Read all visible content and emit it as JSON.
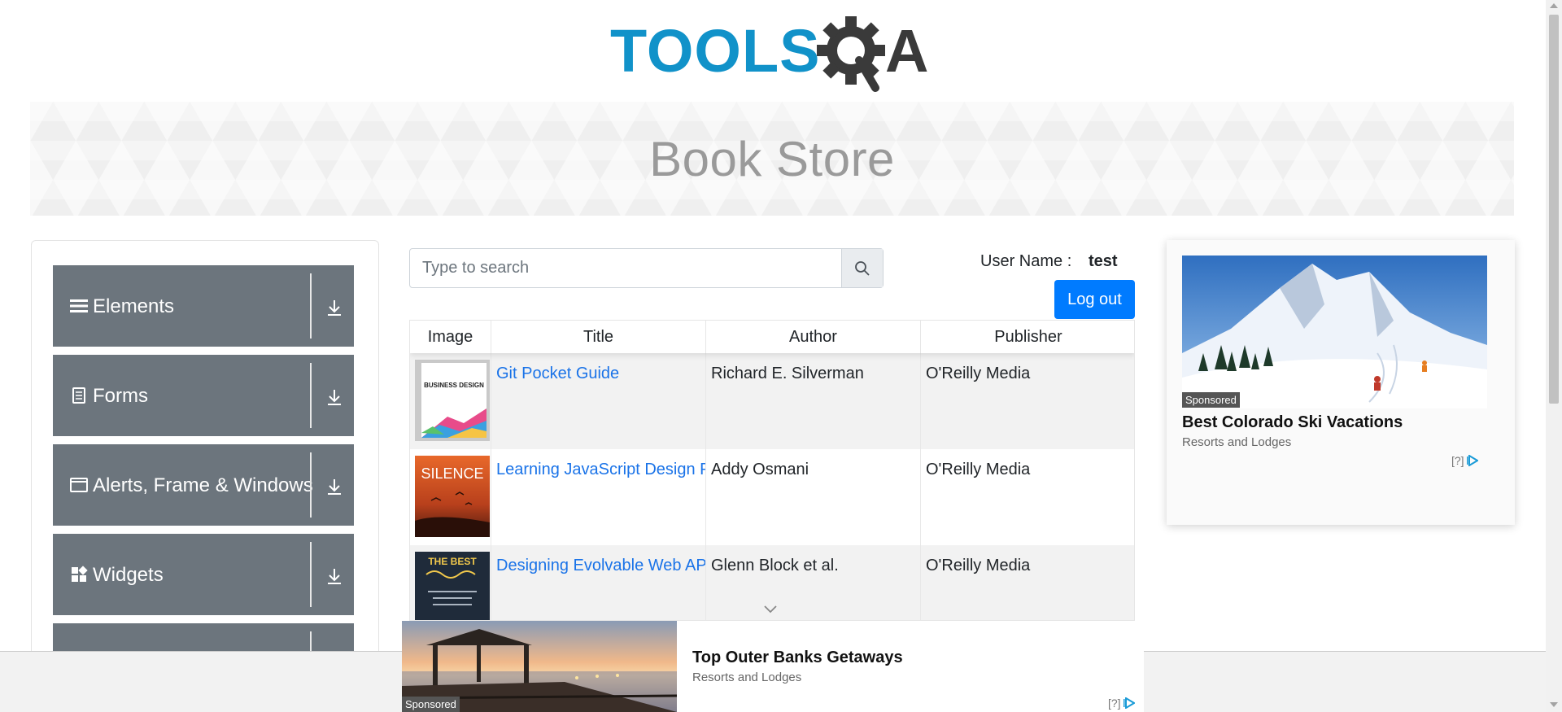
{
  "header": {
    "logo_text": "TOOLSQA"
  },
  "banner": {
    "title": "Book Store"
  },
  "sidebar": {
    "groups": [
      {
        "label": "Elements",
        "icon": "menu-lines-icon"
      },
      {
        "label": "Forms",
        "icon": "document-icon"
      },
      {
        "label": "Alerts, Frame & Windows",
        "icon": "window-icon"
      },
      {
        "label": "Widgets",
        "icon": "widgets-grid-icon"
      },
      {
        "label": "",
        "icon": ""
      }
    ]
  },
  "search": {
    "placeholder": "Type to search"
  },
  "user": {
    "label": "User Name :",
    "value": "test",
    "logout_label": "Log out"
  },
  "table": {
    "columns": [
      "Image",
      "Title",
      "Author",
      "Publisher"
    ],
    "rows": [
      {
        "title": "Git Pocket Guide",
        "author": "Richard E. Silverman",
        "publisher": "O'Reilly Media",
        "cover": "BUSINESS DESIGN"
      },
      {
        "title": "Learning JavaScript Design Patterns",
        "author": "Addy Osmani",
        "publisher": "O'Reilly Media",
        "cover": "SILENCE"
      },
      {
        "title": "Designing Evolvable Web APIs with ASP.NET",
        "author": "Glenn Block et al.",
        "publisher": "O'Reilly Media",
        "cover": "THE BEST"
      }
    ]
  },
  "ads": {
    "right": {
      "badge": "Sponsored",
      "headline": "Best Colorado Ski Vacations",
      "sub": "Resorts and Lodges",
      "choice": "[?]"
    },
    "bottom": {
      "badge": "Sponsored",
      "headline": "Top Outer Banks Getaways",
      "sub": "Resorts and Lodges",
      "choice": "[?]"
    }
  },
  "colors": {
    "primary": "#007bff",
    "sidebar_group": "#6c757d",
    "logo_blue": "#1192c9",
    "logo_dark": "#3a3a3a",
    "link": "#1a73e8"
  }
}
